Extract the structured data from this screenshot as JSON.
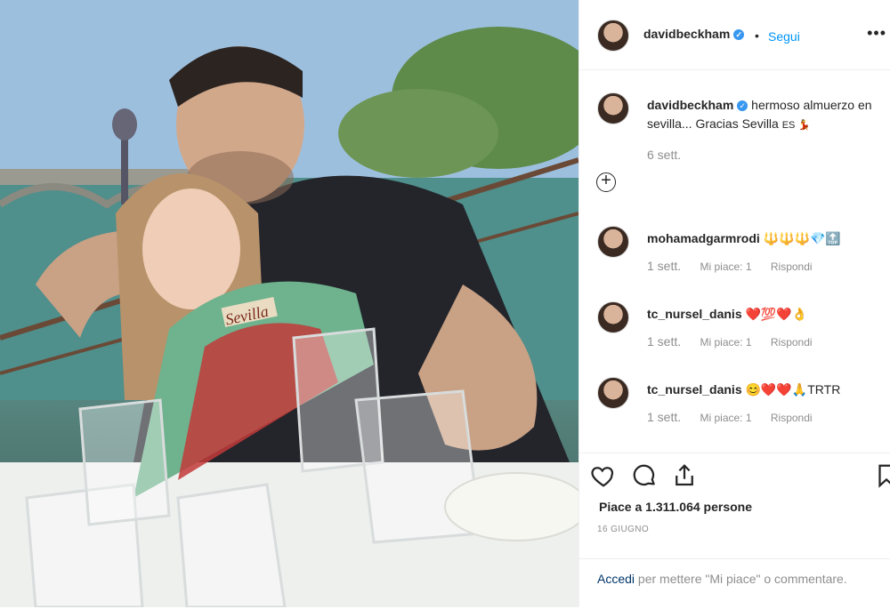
{
  "post": {
    "username": "davidbeckham",
    "follow_label": "Segui",
    "more_label": "•••",
    "separator": "•"
  },
  "caption": {
    "username": "davidbeckham",
    "text": "hermoso almuerzo en sevilla... Gracias Sevilla",
    "emoji": "ES 💃",
    "date": "6 sett."
  },
  "comments": [
    {
      "username": "mohamadgarmrodi",
      "text": "🔱🔱🔱💎🔝",
      "time": "1 sett.",
      "likes": "Mi piace: 1",
      "reply": "Rispondi"
    },
    {
      "username": "tc_nursel_danis",
      "text": "❤️💯❤️👌",
      "time": "1 sett.",
      "likes": "Mi piace: 1",
      "reply": "Rispondi"
    },
    {
      "username": "tc_nursel_danis",
      "text": "😊❤️❤️🙏TRTR",
      "time": "1 sett.",
      "likes": "Mi piace: 1",
      "reply": "Rispondi"
    }
  ],
  "likes_text": "Piace a 1.311.064 persone",
  "post_date": "16 GIUGNO",
  "login": {
    "link": "Accedi",
    "rest": " per mettere \"Mi piace\" o commentare."
  },
  "photo": {
    "fan_label": "Sevilla"
  },
  "colors": {
    "link_blue": "#0095f6",
    "verified": "#3897f0",
    "muted": "#8e8e8e"
  }
}
